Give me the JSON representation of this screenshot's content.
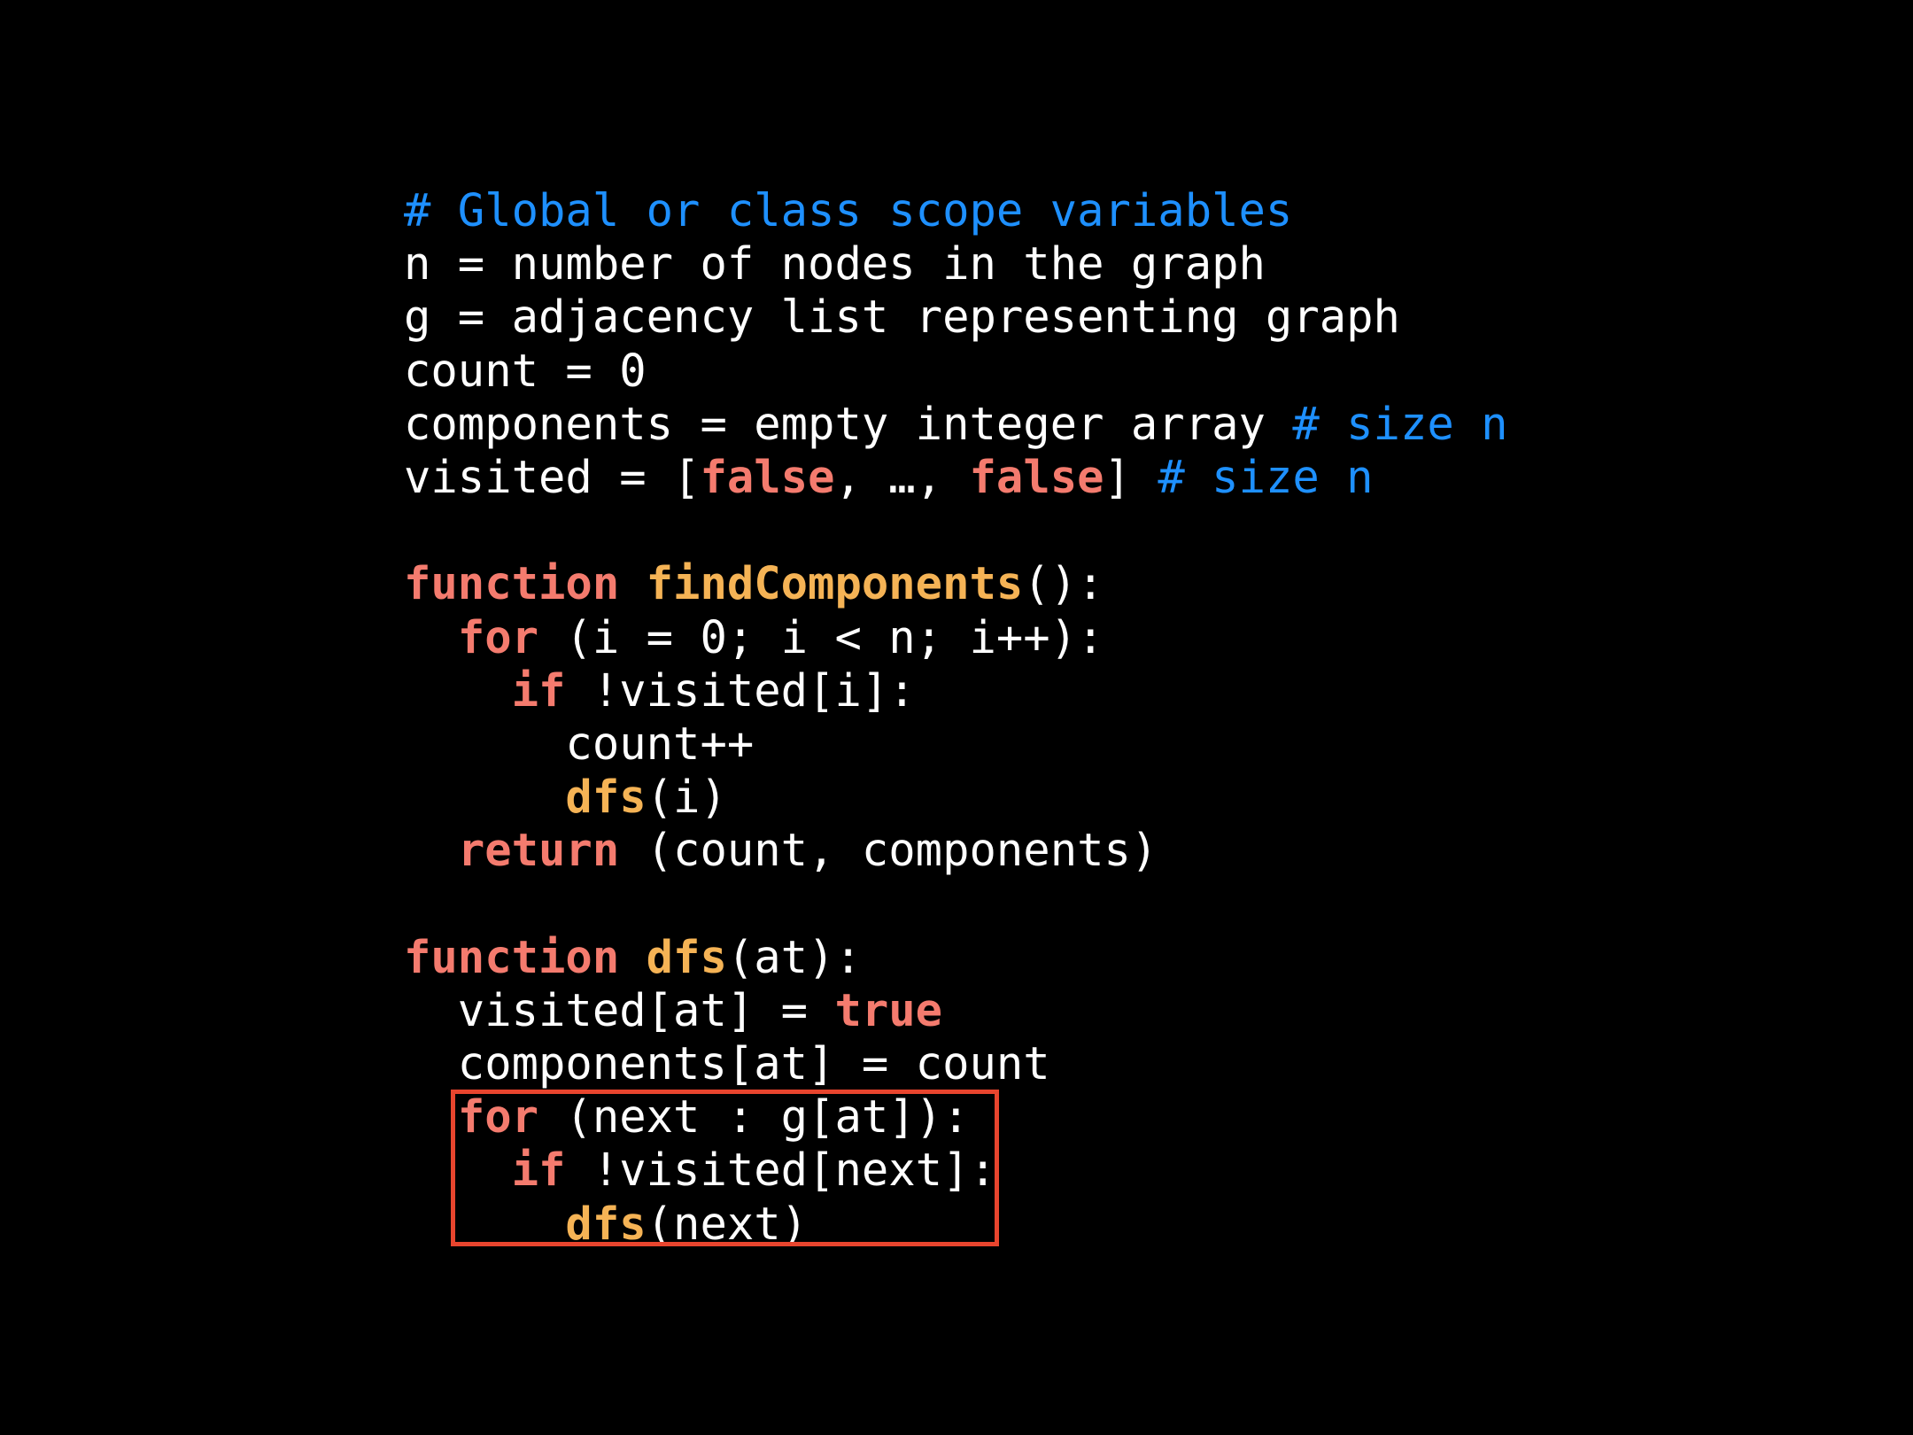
{
  "code": {
    "lines": [
      [
        {
          "t": "# Global or class scope variables",
          "c": "cm"
        }
      ],
      [
        {
          "t": "n = number of nodes in the graph",
          "c": ""
        }
      ],
      [
        {
          "t": "g = adjacency list representing graph",
          "c": ""
        }
      ],
      [
        {
          "t": "count = 0",
          "c": ""
        }
      ],
      [
        {
          "t": "components = empty integer array ",
          "c": ""
        },
        {
          "t": "# size n",
          "c": "cm"
        }
      ],
      [
        {
          "t": "visited = [",
          "c": ""
        },
        {
          "t": "false",
          "c": "lit"
        },
        {
          "t": ", …, ",
          "c": ""
        },
        {
          "t": "false",
          "c": "lit"
        },
        {
          "t": "] ",
          "c": ""
        },
        {
          "t": "# size n",
          "c": "cm"
        }
      ],
      [
        {
          "t": "",
          "c": ""
        }
      ],
      [
        {
          "t": "function",
          "c": "kw"
        },
        {
          "t": " ",
          "c": ""
        },
        {
          "t": "findComponents",
          "c": "fn"
        },
        {
          "t": "():",
          "c": ""
        }
      ],
      [
        {
          "t": "  ",
          "c": ""
        },
        {
          "t": "for",
          "c": "kw"
        },
        {
          "t": " (i = 0; i < n; i++):",
          "c": ""
        }
      ],
      [
        {
          "t": "    ",
          "c": ""
        },
        {
          "t": "if",
          "c": "kw"
        },
        {
          "t": " !visited[i]:",
          "c": ""
        }
      ],
      [
        {
          "t": "      count++",
          "c": ""
        }
      ],
      [
        {
          "t": "      ",
          "c": ""
        },
        {
          "t": "dfs",
          "c": "fn"
        },
        {
          "t": "(i)",
          "c": ""
        }
      ],
      [
        {
          "t": "  ",
          "c": ""
        },
        {
          "t": "return",
          "c": "kw"
        },
        {
          "t": " (count, components)",
          "c": ""
        }
      ],
      [
        {
          "t": "",
          "c": ""
        }
      ],
      [
        {
          "t": "function",
          "c": "kw"
        },
        {
          "t": " ",
          "c": ""
        },
        {
          "t": "dfs",
          "c": "fn"
        },
        {
          "t": "(at):",
          "c": ""
        }
      ],
      [
        {
          "t": "  visited[at] = ",
          "c": ""
        },
        {
          "t": "true",
          "c": "lit"
        }
      ],
      [
        {
          "t": "  components[at] = count",
          "c": ""
        }
      ],
      [
        {
          "t": "  ",
          "c": ""
        },
        {
          "t": "for",
          "c": "kw"
        },
        {
          "t": " (next : g[at]):",
          "c": ""
        }
      ],
      [
        {
          "t": "    ",
          "c": ""
        },
        {
          "t": "if",
          "c": "kw"
        },
        {
          "t": " !visited[next]:",
          "c": ""
        }
      ],
      [
        {
          "t": "      ",
          "c": ""
        },
        {
          "t": "dfs",
          "c": "fn"
        },
        {
          "t": "(next)",
          "c": ""
        }
      ]
    ]
  },
  "colors": {
    "background": "#000000",
    "text": "#ffffff",
    "keyword": "#f47b6e",
    "function_name": "#f5b355",
    "comment": "#1e90ff",
    "highlight_border": "#e8452e"
  }
}
